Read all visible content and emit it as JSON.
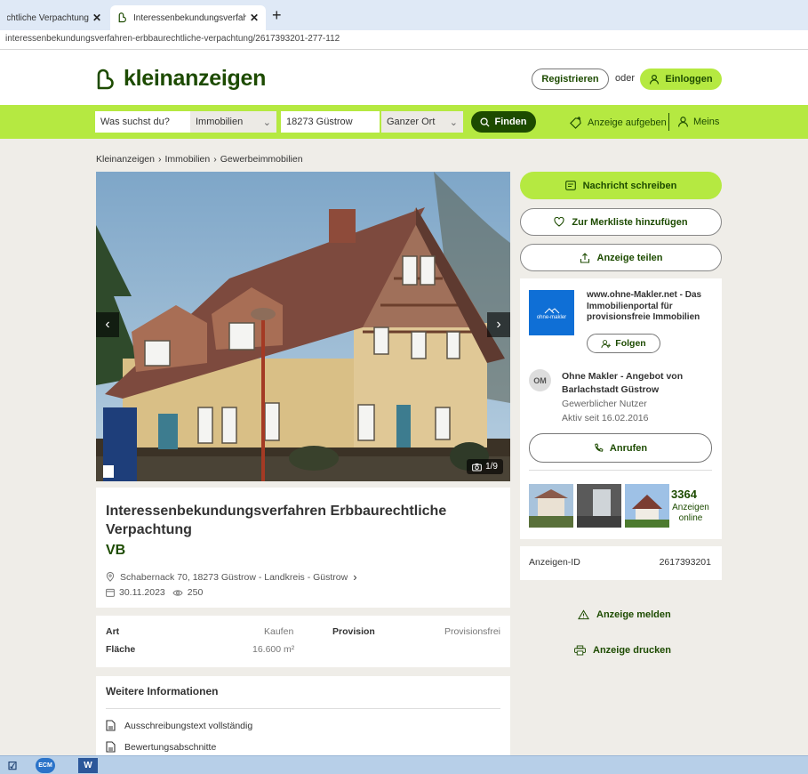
{
  "browser": {
    "tabs": [
      {
        "title": "Interessenbekundungsverfahren Erbbaurechtliche Verpachtung",
        "active": false
      },
      {
        "title": "Interessenbekundungsverfahren Erbbaurechtliche Verpachtung",
        "active": true
      }
    ],
    "url": "interessenbekundungsverfahren-erbbaurechtliche-verpachtung/2617393201-277-112"
  },
  "header": {
    "logo_text": "kleinanzeigen",
    "register_label": "Registrieren",
    "or_label": "oder",
    "login_label": "Einloggen"
  },
  "search": {
    "query_placeholder": "Was suchst du?",
    "category": "Immobilien",
    "location": "18273 Güstrow",
    "radius": "Ganzer Ort",
    "find_label": "Finden",
    "post_ad_label": "Anzeige aufgeben",
    "meins_label": "Meins"
  },
  "breadcrumb": [
    "Kleinanzeigen",
    "Immobilien",
    "Gewerbeimmobilien"
  ],
  "gallery": {
    "counter": "1/9"
  },
  "ad": {
    "title": "Interessenbekundungsverfahren Erbbaurechtliche Verpachtung",
    "price": "VB",
    "location": "Schabernack 70, 18273 Güstrow - Landkreis - Güstrow",
    "date": "30.11.2023",
    "views": "250"
  },
  "details": [
    {
      "key": "Art",
      "value": "Kaufen",
      "key2": "Provision",
      "value2": "Provisionsfrei"
    },
    {
      "key": "Fläche",
      "value": "16.600 m²"
    }
  ],
  "more_info": {
    "title": "Weitere Informationen",
    "documents": [
      "Ausschreibungstext vollständig",
      "Bewertungsabschnitte"
    ]
  },
  "actions": {
    "message": "Nachricht schreiben",
    "watchlist": "Zur Merkliste hinzufügen",
    "share": "Anzeige teilen",
    "report": "Anzeige melden",
    "print": "Anzeige drucken"
  },
  "seller": {
    "logo_text": "ohne-makler",
    "portal": "www.ohne-Makler.net - Das Immobilienportal für provisionsfreie Immobilien",
    "follow_label": "Folgen",
    "initials": "OM",
    "name": "Ohne Makler - Angebot von Barlachstadt Güstrow",
    "type": "Gewerblicher Nutzer",
    "since": "Aktiv seit 16.02.2016",
    "call_label": "Anrufen",
    "ads_count": "3364",
    "ads_label": "Anzeigen online"
  },
  "ad_id": {
    "label": "Anzeigen-ID",
    "value": "2617393201"
  },
  "taskbar": {
    "items": [
      "ECM",
      "W"
    ]
  },
  "colors": {
    "brand_green": "#b5e941",
    "brand_dark": "#1d4b00",
    "background": "#efede8"
  }
}
